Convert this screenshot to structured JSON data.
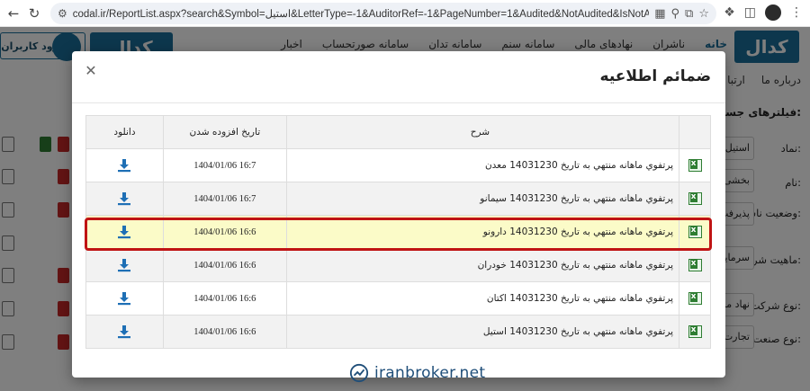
{
  "browser": {
    "url": "codal.ir/ReportList.aspx?search&Symbol=استیل&LetterType=-1&AuditorRef=-1&PageNumber=1&Audited&NotAudited&IsNotAudited=fal..."
  },
  "site": {
    "login_label": "ورود کاربران",
    "logo_text": "کدال",
    "nav": [
      "خانه",
      "ناشران",
      "نهادهای مالی",
      "سامانه سنم",
      "سامانه تدان",
      "سامانه صورتحساب",
      "اخبار"
    ],
    "subnav": [
      "درباره ما",
      "ارتبا"
    ],
    "filters_title": "فیلترهای جستجو:",
    "filters": [
      {
        "label": "نماد:",
        "value": "استیل"
      },
      {
        "label": "نام:",
        "value": "بخشی"
      },
      {
        "label": "وضعیت ناشر:",
        "value": "پذیرفت"
      },
      {
        "label": "ماهیت شرکت:",
        "value": "سرمایه"
      },
      {
        "label": "نوع شرکت:",
        "value": "نهاد ما"
      },
      {
        "label": "نوع صنعت:",
        "value": "تجارت"
      }
    ]
  },
  "modal": {
    "title": "ضمائم اطلاعیه",
    "close_icon": "close-icon",
    "columns": {
      "desc": "شرح",
      "date": "تاریخ افزوده شدن",
      "download": "دانلود"
    },
    "rows": [
      {
        "desc": "پرتفوي ماهانه منتهي به تاريخ 14031230 معدن",
        "date": "1404/01/06 16:7",
        "highlighted": false
      },
      {
        "desc": "پرتفوي ماهانه منتهي به تاريخ 14031230 سيمانو",
        "date": "1404/01/06 16:7",
        "highlighted": false
      },
      {
        "desc": "پرتفوي ماهانه منتهي به تاريخ 14031230 دارونو",
        "date": "1404/01/06 16:6",
        "highlighted": true
      },
      {
        "desc": "پرتفوي ماهانه منتهي به تاريخ 14031230 خودران",
        "date": "1404/01/06 16:6",
        "highlighted": false
      },
      {
        "desc": "پرتفوي ماهانه منتهي به تاريخ 14031230 اكتان",
        "date": "1404/01/06 16:6",
        "highlighted": false
      },
      {
        "desc": "پرتفوي ماهانه منتهي به تاريخ 14031230 استيل",
        "date": "1404/01/06 16:6",
        "highlighted": false
      }
    ]
  },
  "watermark": {
    "text": "iranbroker.net"
  },
  "colors": {
    "brand": "#1b6f9a",
    "highlight_border": "#c01414",
    "highlight_bg": "#fbfbc8",
    "download": "#1e6fb5",
    "excel": "#2e7d32"
  }
}
